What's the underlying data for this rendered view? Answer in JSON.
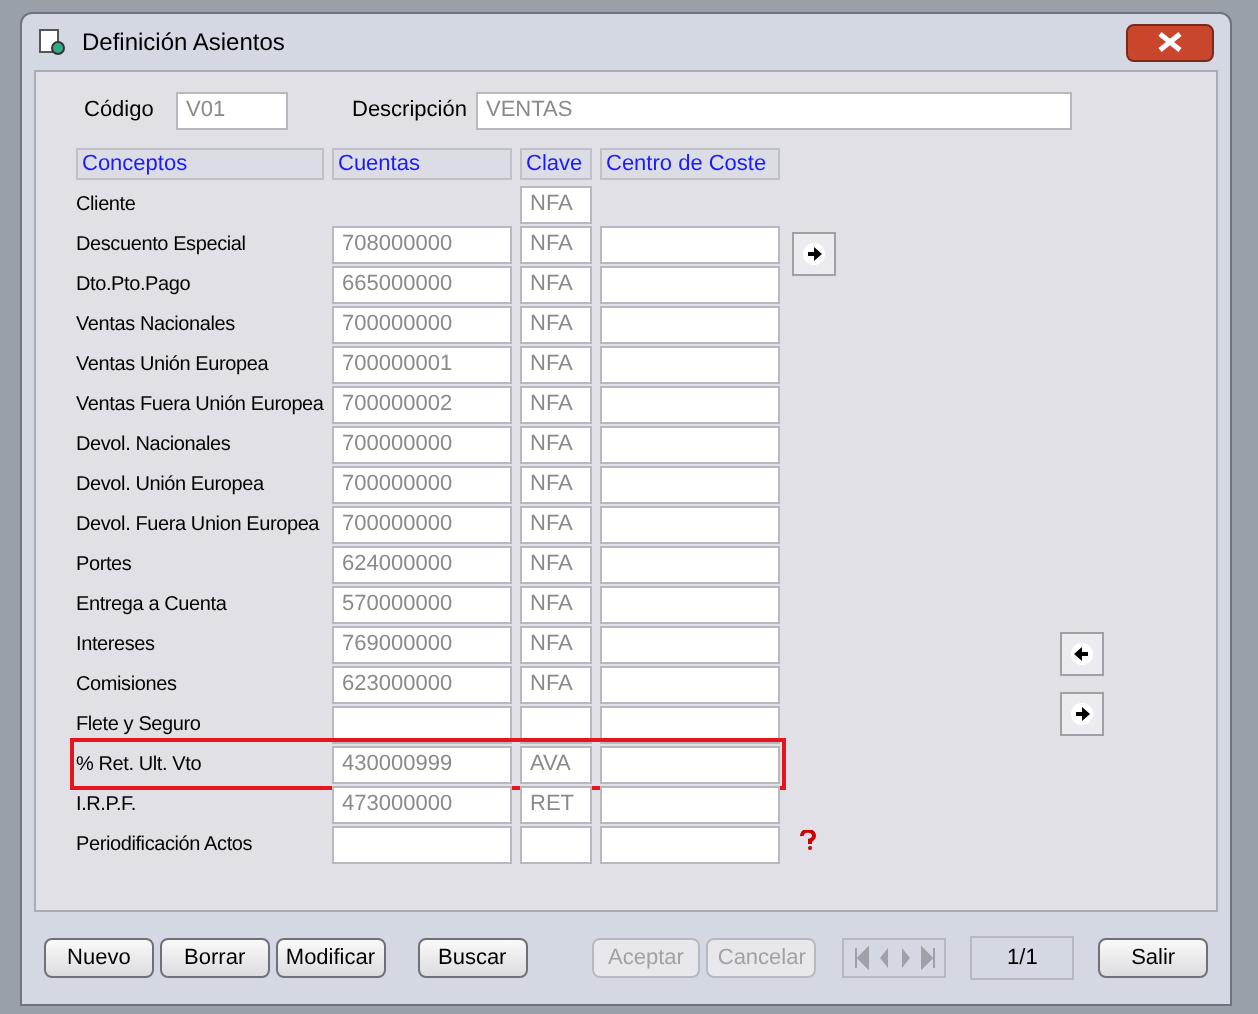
{
  "window": {
    "title": "Definición Asientos"
  },
  "header": {
    "code_label": "Código",
    "code_value": "V01",
    "description_label": "Descripción",
    "description_value": "VENTAS"
  },
  "table": {
    "columns": [
      "Conceptos",
      "Cuentas",
      "Clave",
      "Centro de Coste"
    ],
    "rows": [
      {
        "concept": "Cliente",
        "key": "NFA",
        "kind": "key_only",
        "highlighted": false
      },
      {
        "concept": "Descuento Especial",
        "account": "708000000",
        "key": "NFA",
        "kind": "full",
        "highlighted": false
      },
      {
        "concept": "Dto.Pto.Pago",
        "account": "665000000",
        "key": "NFA",
        "kind": "full",
        "highlighted": false
      },
      {
        "concept": "Ventas Nacionales",
        "account": "700000000",
        "key": "NFA",
        "kind": "full",
        "highlighted": false
      },
      {
        "concept": "Ventas Unión Europea",
        "account": "700000001",
        "key": "NFA",
        "kind": "full",
        "highlighted": false
      },
      {
        "concept": "Ventas Fuera Unión Europea",
        "account": "700000002",
        "key": "NFA",
        "kind": "full",
        "highlighted": false
      },
      {
        "concept": "Devol. Nacionales",
        "account": "700000000",
        "key": "NFA",
        "kind": "full",
        "highlighted": false
      },
      {
        "concept": "Devol. Unión Europea",
        "account": "700000000",
        "key": "NFA",
        "kind": "full",
        "highlighted": false
      },
      {
        "concept": "Devol. Fuera Union Europea",
        "account": "700000000",
        "key": "NFA",
        "kind": "full",
        "highlighted": false
      },
      {
        "concept": "Portes",
        "account": "624000000",
        "key": "NFA",
        "kind": "full",
        "highlighted": false
      },
      {
        "concept": "Entrega a Cuenta",
        "account": "570000000",
        "key": "NFA",
        "kind": "full",
        "highlighted": false
      },
      {
        "concept": "Intereses",
        "account": "769000000",
        "key": "NFA",
        "kind": "full",
        "highlighted": false
      },
      {
        "concept": "Comisiones",
        "account": "623000000",
        "key": "NFA",
        "kind": "full",
        "highlighted": false
      },
      {
        "concept": "Flete y Seguro",
        "kind": "full",
        "highlighted": false
      },
      {
        "concept": "% Ret. Ult. Vto",
        "account": "430000999",
        "key": "AVA",
        "kind": "full",
        "highlighted": true
      },
      {
        "concept": "I.R.P.F.",
        "account": "473000000",
        "key": "RET",
        "kind": "full",
        "highlighted": false
      },
      {
        "concept": "Periodificación Actos",
        "kind": "full",
        "highlighted": false
      }
    ]
  },
  "buttons": [
    {
      "label": "Nuevo",
      "disabled": false
    },
    {
      "label": "Borrar",
      "disabled": false
    },
    {
      "label": "Modificar",
      "disabled": false
    },
    {
      "label": "Buscar",
      "disabled": false
    },
    {
      "label": "Aceptar",
      "disabled": true
    },
    {
      "label": "Cancelar",
      "disabled": true
    }
  ],
  "record_counter": "1/1",
  "exit_button": {
    "label": "Salir"
  }
}
